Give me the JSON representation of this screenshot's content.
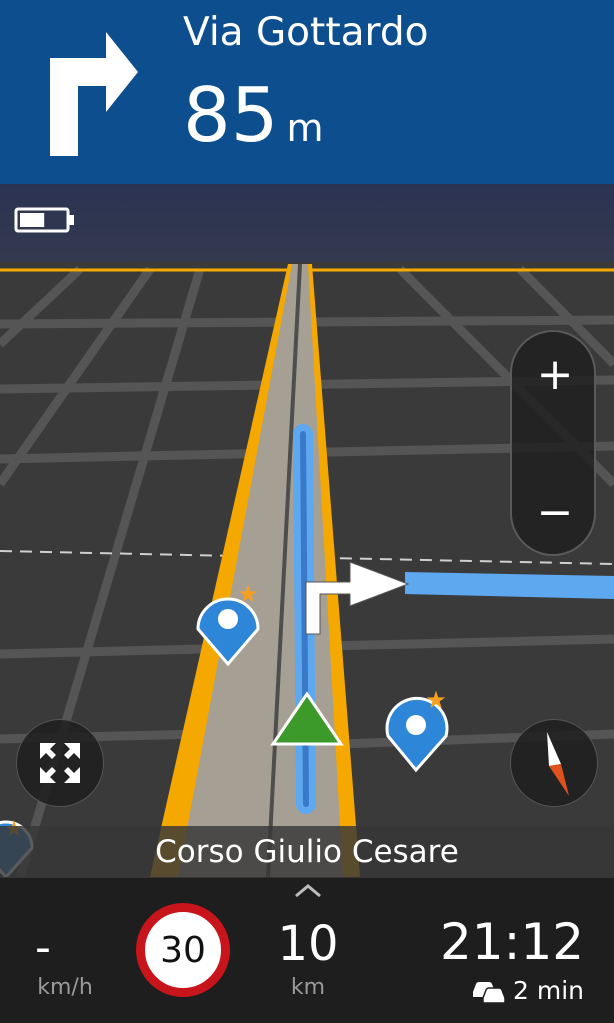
{
  "maneuver": {
    "street": "Via Gottardo",
    "distance": "85",
    "distance_unit": "m",
    "direction_icon": "turn-right-icon"
  },
  "status": {
    "battery_level": 0.55
  },
  "map": {
    "zoom_in_label": "+",
    "zoom_out_label": "−",
    "current_road": "Corso Giulio Cesare"
  },
  "footer": {
    "speed": "-",
    "speed_unit": "km/h",
    "speed_limit": "30",
    "remaining_distance": "10",
    "remaining_unit": "km",
    "arrival_time": "21:12",
    "traffic_delay": "2 min"
  },
  "colors": {
    "header_bg": "#0d4f8e",
    "route_blue": "#5ea8f0",
    "road_orange": "#f5a800",
    "limit_red": "#c8151b",
    "position_green": "#3b9a2a"
  }
}
